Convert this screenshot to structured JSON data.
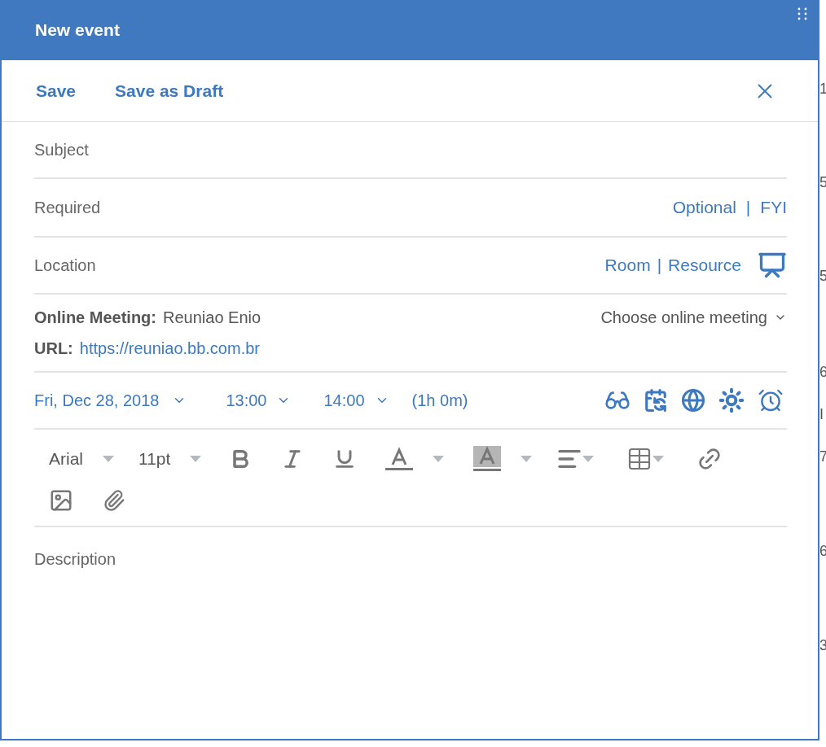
{
  "dialog": {
    "title": "New event"
  },
  "actions": [
    {
      "label": "Save"
    },
    {
      "label": "Save as Draft"
    }
  ],
  "fields": [
    {
      "kind": "plain",
      "placeholder": "Subject"
    },
    {
      "kind": "attendees",
      "placeholder": "Required",
      "links": [
        "Optional",
        "FYI"
      ],
      "separator": "|"
    },
    {
      "kind": "location",
      "placeholder": "Location",
      "links": [
        "Room",
        "Resource"
      ],
      "separator": "|"
    }
  ],
  "online_meeting": {
    "label": "Online Meeting:",
    "value": "Reuniao Enio",
    "chooser": "Choose online meeting",
    "url_label": "URL:",
    "url": "https://reuniao.bb.com.br"
  },
  "schedule": {
    "date": "Fri, Dec 28, 2018",
    "start": "13:00",
    "end": "14:00",
    "duration": "(1h 0m)"
  },
  "toolbar": {
    "font": "Arial",
    "size": "11pt"
  },
  "description": {
    "placeholder": "Description"
  },
  "background_calendar": {
    "cut_labels": [
      "1",
      "5",
      "5",
      "6",
      "I",
      "7",
      "6",
      "3"
    ]
  }
}
